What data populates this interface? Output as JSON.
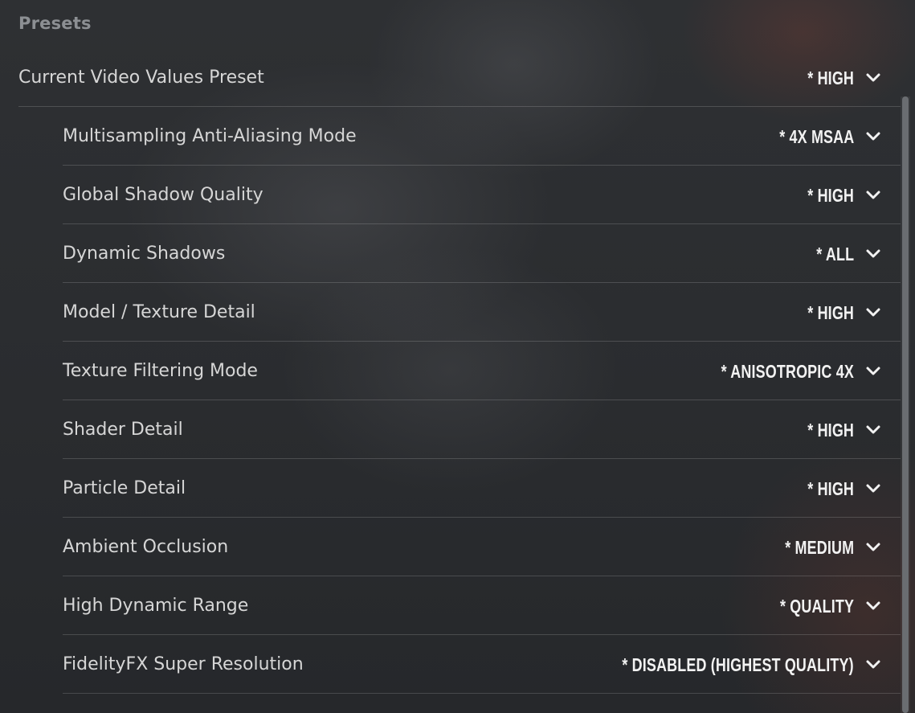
{
  "section": {
    "title": "Presets"
  },
  "preset": {
    "label": "Current Video Values Preset",
    "value": "* HIGH"
  },
  "settings": [
    {
      "label": "Multisampling Anti-Aliasing Mode",
      "value": "* 4X MSAA"
    },
    {
      "label": "Global Shadow Quality",
      "value": "* HIGH"
    },
    {
      "label": "Dynamic Shadows",
      "value": "* ALL"
    },
    {
      "label": "Model / Texture Detail",
      "value": "* HIGH"
    },
    {
      "label": "Texture Filtering Mode",
      "value": "* ANISOTROPIC 4X"
    },
    {
      "label": "Shader Detail",
      "value": "* HIGH"
    },
    {
      "label": "Particle Detail",
      "value": "* HIGH"
    },
    {
      "label": "Ambient Occlusion",
      "value": "* MEDIUM"
    },
    {
      "label": "High Dynamic Range",
      "value": "* QUALITY"
    },
    {
      "label": "FidelityFX Super Resolution",
      "value": "* DISABLED (HIGHEST QUALITY)"
    }
  ],
  "icons": {
    "dropdown": "chevron-down-icon"
  }
}
